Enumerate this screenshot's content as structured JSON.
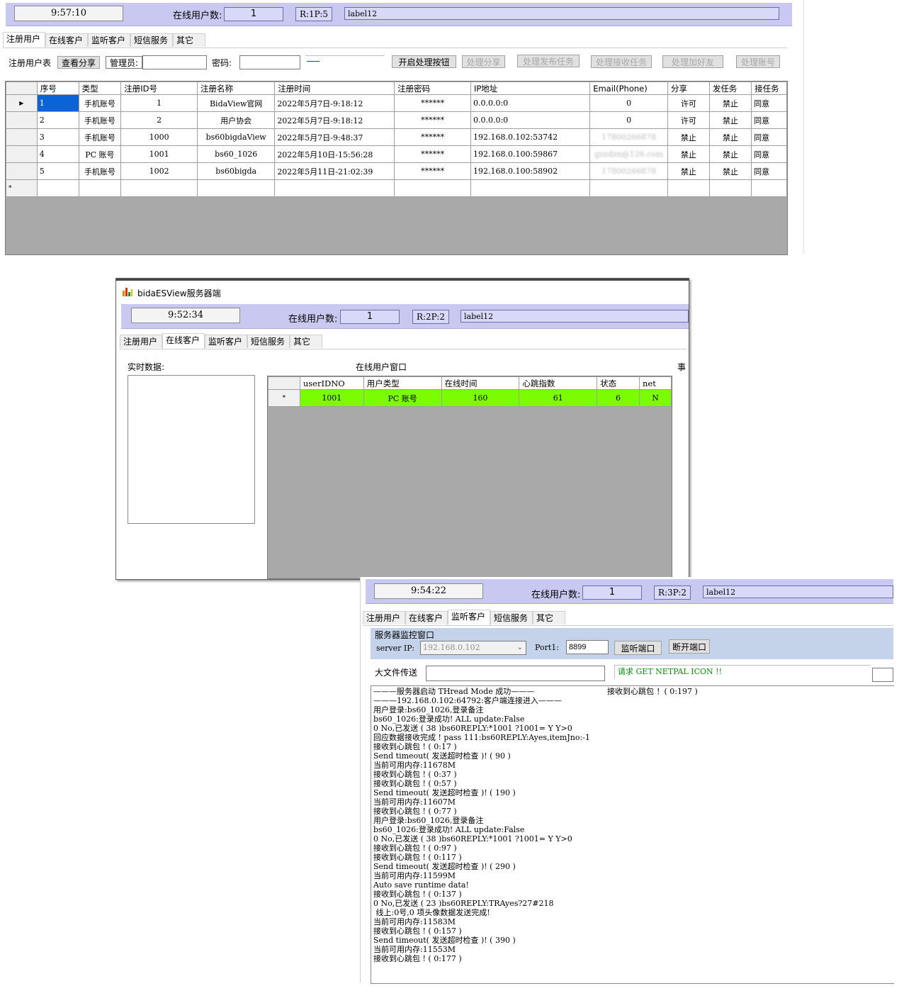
{
  "win1": {
    "time": "9:57:10",
    "online_label": "在线用户数:",
    "online_count": "1",
    "rp": "R:1P:5",
    "label12": "label12",
    "tabs": [
      "注册用户",
      "在线客户",
      "监听客户",
      "短信服务",
      "其它"
    ],
    "toolbar": {
      "user_table_label": "注册用户表",
      "view_share": "查看分享",
      "admin_label": "管理员:",
      "password_label": "密码:",
      "open_btn": "开启处理按钮",
      "handle_share": "处理分享",
      "handle_publish": "处理发布任务",
      "handle_receive": "处理接收任务",
      "handle_friend": "处理加好友",
      "handle_account": "处理账号"
    },
    "columns": [
      "序号",
      "类型",
      "注册ID号",
      "注册名称",
      "注册时间",
      "注册密码",
      "IP地址",
      "Email(Phone)",
      "分享",
      "发任务",
      "接任务"
    ],
    "rows": [
      [
        "1",
        "手机账号",
        "1",
        "BidaView官网",
        "2022年5月7日-9:18:12",
        "******",
        "0.0.0.0:0",
        "0",
        "许可",
        "禁止",
        "同意"
      ],
      [
        "2",
        "手机账号",
        "2",
        "用户协会",
        "2022年5月7日-9:18:12",
        "******",
        "0.0.0.0:0",
        "0",
        "许可",
        "禁止",
        "同意"
      ],
      [
        "3",
        "手机账号",
        "1000",
        "bs60bigdaView",
        "2022年5月7日-9:48:37",
        "******",
        "192.168.0.102:53742",
        "17800266878",
        "禁止",
        "禁止",
        "同意"
      ],
      [
        "4",
        "PC 账号",
        "1001",
        "bs60_1026",
        "2022年5月10日-15:56:28",
        "******",
        "192.168.0.100:59867",
        "gzzdzn@126.com",
        "禁止",
        "禁止",
        "同意"
      ],
      [
        "5",
        "手机账号",
        "1002",
        "bs60bigda",
        "2022年5月11日-21:02:39",
        "******",
        "192.168.0.100:58902",
        "17800266878",
        "禁止",
        "禁止",
        "同意"
      ]
    ],
    "new_row_marker": "*"
  },
  "win2": {
    "title": "bidaESView服务器端",
    "time": "9:52:34",
    "online_label": "在线用户数:",
    "online_count": "1",
    "rp": "R:2P:2",
    "label12": "label12",
    "tabs": [
      "注册用户",
      "在线客户",
      "监听客户",
      "短信服务",
      "其它"
    ],
    "realtime_label": "实时数据:",
    "online_window_label": "在线用户窗口",
    "side_label": "事",
    "columns": [
      "userIDNO",
      "用户类型",
      "在线时间",
      "心跳指数",
      "状态",
      "net"
    ],
    "row": {
      "marker": "*",
      "userIDNO": "1001",
      "type": "PC 账号",
      "online_time": "160",
      "heartbeat": "61",
      "status": "6",
      "net": "N"
    },
    "row_color": "#7cfc00"
  },
  "win3": {
    "time": "9:54:22",
    "online_label": "在线用户数:",
    "online_count": "1",
    "rp": "R:3P:2",
    "label12": "label12",
    "tabs": [
      "注册用户",
      "在线客户",
      "监听客户",
      "短信服务",
      "其它"
    ],
    "monitor_title": "服务器监控窗口",
    "server_ip_label": "server IP:",
    "server_ip": "192.168.0.102",
    "port_label": "Port1:",
    "port": "8899",
    "listen_btn": "监听端口",
    "disconnect_btn": "断开端口",
    "bigfile_label": "大文件传送",
    "request_text": "请求 GET NETPAL ICON !!",
    "heartbeat_right": "接收到心跳包 ！( 0:197 )",
    "log": "———服务器启动 THread Mode 成功———\n———192.168.0.102:64792:客户端连接进入———\n用户登录:bs60_1026,登录备注\nbs60_1026:登录成功! ALL update:False\n0 No,已发送 ( 38 )bs60REPLY:*1001 ?1001= Y Y>0\n回应数据接收完成 ! pass 111:bs60REPLY:Ayes,itemJno:-1\n接收到心跳包 ! ( 0:17 )\nSend timeout( 发送超时检查 )! ( 90 )\n当前可用内存:11678M\n接收到心跳包 ! ( 0:37 )\n接收到心跳包 ! ( 0:57 )\nSend timeout( 发送超时检查 )! ( 190 )\n当前可用内存:11607M\n接收到心跳包 ! ( 0:77 )\n用户登录:bs60_1026,登录备注\nbs60_1026:登录成功! ALL update:False\n0 No,已发送 ( 38 )bs60REPLY:*1001 ?1001= Y Y>0\n接收到心跳包 ! ( 0:97 )\n接收到心跳包 ! ( 0:117 )\nSend timeout( 发送超时检查 )! ( 290 )\n当前可用内存:11599M\nAuto save runtime data!\n接收到心跳包 ! ( 0:137 )\n0 No,已发送 ( 23 )bs60REPLY:TRAyes?27#218\n 线上:0号,0 项头像数据发送完成!\n当前可用内存:11583M\n接收到心跳包 ! ( 0:157 )\nSend timeout( 发送超时检查 )! ( 390 )\n当前可用内存:11553M\n接收到心跳包 ! ( 0:177 )"
  }
}
